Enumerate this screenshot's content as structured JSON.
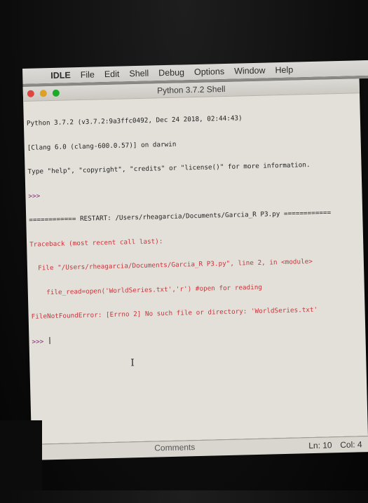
{
  "menubar": {
    "apple_icon": "",
    "items": [
      "IDLE",
      "File",
      "Edit",
      "Shell",
      "Debug",
      "Options",
      "Window",
      "Help"
    ]
  },
  "window": {
    "title": "Python 3.7.2 Shell"
  },
  "shell": {
    "lines": [
      {
        "text": "Python 3.7.2 (v3.7.2:9a3ffc0492, Dec 24 2018, 02:44:43)",
        "kind": "normal"
      },
      {
        "text": "[Clang 6.0 (clang-600.0.57)] on darwin",
        "kind": "normal"
      },
      {
        "text": "Type \"help\", \"copyright\", \"credits\" or \"license()\" for more information.",
        "kind": "normal"
      },
      {
        "text": ">>> ",
        "kind": "prompt"
      },
      {
        "text": "============ RESTART: /Users/rheagarcia/Documents/Garcia_R P3.py ============",
        "kind": "restart"
      },
      {
        "text": "Traceback (most recent call last):",
        "kind": "error"
      },
      {
        "text": "  File \"/Users/rheagarcia/Documents/Garcia_R P3.py\", line 2, in <module>",
        "kind": "error"
      },
      {
        "text": "    file_read=open('WorldSeries.txt','r') #open for reading",
        "kind": "error"
      },
      {
        "text": "FileNotFoundError: [Errno 2] No such file or directory: 'WorldSeries.txt'",
        "kind": "error"
      }
    ],
    "current_prompt": ">>> "
  },
  "statusbar": {
    "partial_label": "Comments",
    "line": "Ln: 10",
    "column": "Col: 4"
  }
}
